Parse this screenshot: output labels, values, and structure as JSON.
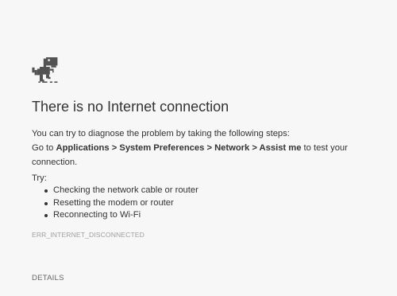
{
  "error_page": {
    "icon": "dino-icon",
    "title": "There is no Internet connection",
    "intro": "You can try to diagnose the problem by taking the following steps:",
    "instruction": {
      "go_to": "Go to",
      "path": "Applications > System Preferences > Network > Assist me",
      "suffix": "to test your connection."
    },
    "try_label": "Try:",
    "suggestions": [
      "Checking the network cable or router",
      "Resetting the modem or router",
      "Reconnecting to Wi-Fi"
    ],
    "error_code": "ERR_INTERNET_DISCONNECTED",
    "details_label": "DETAILS"
  },
  "colors": {
    "background": "#f7f7f7",
    "text": "#333333",
    "error_code": "#a0a0a0",
    "details": "#666666"
  }
}
